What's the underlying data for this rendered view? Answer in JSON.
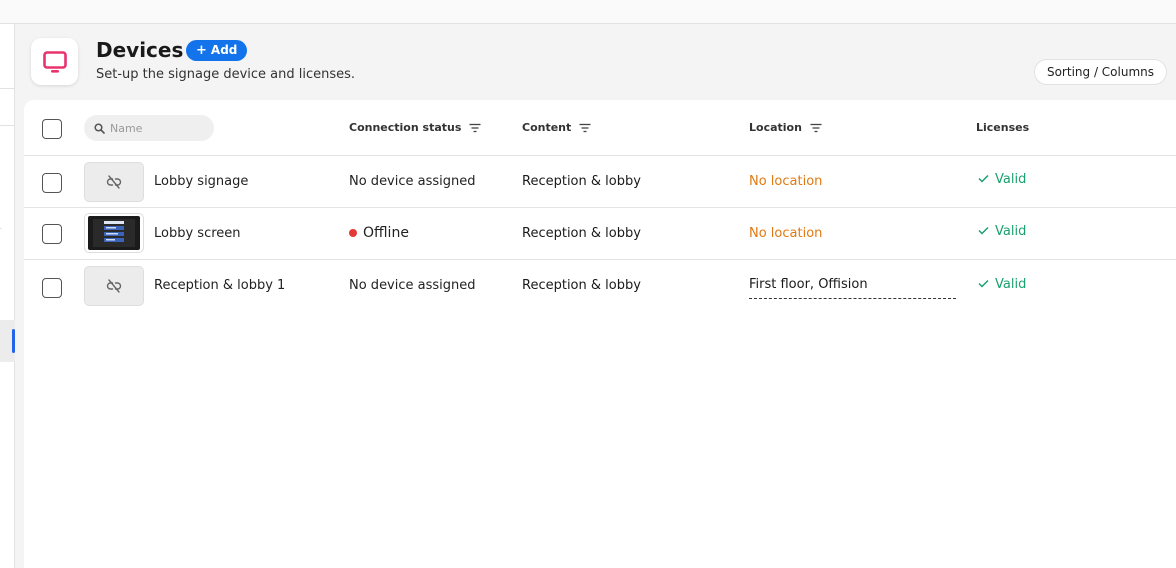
{
  "header": {
    "title": "Devices",
    "add_label": "Add",
    "subtitle": "Set-up the signage device and licenses.",
    "sort_label": "Sorting / Columns"
  },
  "table": {
    "search_placeholder": "Name",
    "columns": {
      "connection": "Connection status",
      "content": "Content",
      "location": "Location",
      "licenses": "Licenses"
    },
    "rows": [
      {
        "name": "Lobby signage",
        "thumbnail": "unlinked-icon",
        "connection": "No device assigned",
        "content": "Reception & lobby",
        "location": "No location",
        "license": "Valid"
      },
      {
        "name": "Lobby screen",
        "thumbnail": "screen-preview",
        "connection": "Offline",
        "content": "Reception & lobby",
        "location": "No location",
        "license": "Valid"
      },
      {
        "name": "Reception & lobby 1",
        "thumbnail": "unlinked-icon",
        "connection": "No device assigned",
        "content": "Reception & lobby",
        "location": "First floor, Offision",
        "license": "Valid"
      }
    ]
  },
  "colors": {
    "accent": "#1273eb",
    "brand_icon": "#e8336d",
    "warning": "#e07a12",
    "success": "#1aa06f",
    "offline": "#e53935"
  }
}
